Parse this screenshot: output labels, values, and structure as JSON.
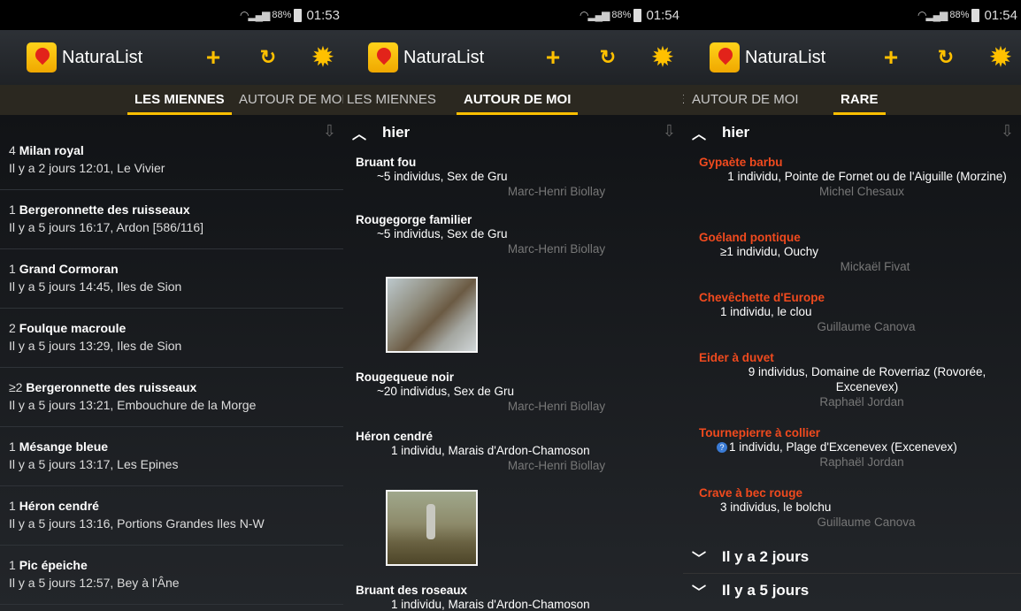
{
  "app": {
    "name": "NaturaList"
  },
  "status": [
    {
      "battery": "88%",
      "time": "01:53"
    },
    {
      "battery": "88%",
      "time": "01:54"
    },
    {
      "battery": "88%",
      "time": "01:54"
    }
  ],
  "tabs": {
    "mine": "LES MIENNES",
    "around": "AUTOUR DE MOI",
    "rare": "RARE"
  },
  "panel1": {
    "observations": [
      {
        "qty": "4",
        "species": "Milan royal",
        "info": "Il y a 2 jours 12:01, Le Vivier"
      },
      {
        "qty": "1",
        "species": "Bergeronnette des ruisseaux",
        "info": "Il y a 5 jours 16:17, Ardon [586/116]"
      },
      {
        "qty": "1",
        "species": "Grand Cormoran",
        "info": "Il y a 5 jours 14:45, Iles de Sion"
      },
      {
        "qty": "2",
        "species": "Foulque macroule",
        "info": "Il y a 5 jours 13:29, Iles de Sion"
      },
      {
        "qty": "≥2",
        "species": "Bergeronnette des ruisseaux",
        "info": "Il y a 5 jours 13:21, Embouchure de la Morge"
      },
      {
        "qty": "1",
        "species": "Mésange bleue",
        "info": "Il y a 5 jours 13:17, Les Epines"
      },
      {
        "qty": "1",
        "species": "Héron cendré",
        "info": "Il y a 5 jours 13:16, Portions Grandes Iles N-W"
      },
      {
        "qty": "1",
        "species": "Pic épeiche",
        "info": "Il y a 5 jours 12:57, Bey à l'Âne"
      }
    ]
  },
  "panel2": {
    "group": "hier",
    "entries": [
      {
        "species": "Bruant fou",
        "detail": "~5 individus, Sex de Gru",
        "observer": "Marc-Henri Biollay"
      },
      {
        "species": "Rougegorge familier",
        "detail": "~5 individus, Sex de Gru",
        "observer": "Marc-Henri Biollay"
      },
      {
        "species": "Rougequeue noir",
        "detail": "~20 individus, Sex de Gru",
        "observer": "Marc-Henri Biollay"
      },
      {
        "species": "Héron cendré",
        "detail": "1 individu, Marais d'Ardon-Chamoson",
        "observer": "Marc-Henri Biollay"
      },
      {
        "species": "Bruant des roseaux",
        "detail": "1 individu, Marais d'Ardon-Chamoson",
        "observer": ""
      }
    ]
  },
  "panel3": {
    "group": "hier",
    "entries": [
      {
        "species": "Gypaète barbu",
        "detail": "1 individu, Pointe de Fornet ou de l'Aiguille (Morzine)",
        "observer": "Michel Chesaux"
      },
      {
        "species": "Goéland pontique",
        "detail": "≥1 individu, Ouchy",
        "observer": "Mickaël Fivat"
      },
      {
        "species": "Chevêchette d'Europe",
        "detail": "1 individu, le clou",
        "observer": "Guillaume Canova"
      },
      {
        "species": "Eider à duvet",
        "detail": "9 individus, Domaine de Roverriaz (Rovorée, Excenevex)",
        "observer": "Raphaël Jordan"
      },
      {
        "species": "Tournepierre à collier",
        "detail": "1 individu, Plage d'Excenevex (Excenevex)",
        "observer": "Raphaël Jordan"
      },
      {
        "species": "Crave à bec rouge",
        "detail": "3 individus, le bolchu",
        "observer": "Guillaume Canova"
      }
    ],
    "collapsed": [
      "Il y a 2 jours",
      "Il y a 5 jours"
    ]
  },
  "colors": {
    "accent": "#ffc000",
    "rare": "#f04a1e",
    "background": "#1a1c1f"
  },
  "icons": [
    "app-logo-icon",
    "add-icon",
    "locate-icon",
    "settings-icon",
    "chevron-up-icon",
    "chevron-down-icon",
    "scroll-icon",
    "question-icon"
  ]
}
